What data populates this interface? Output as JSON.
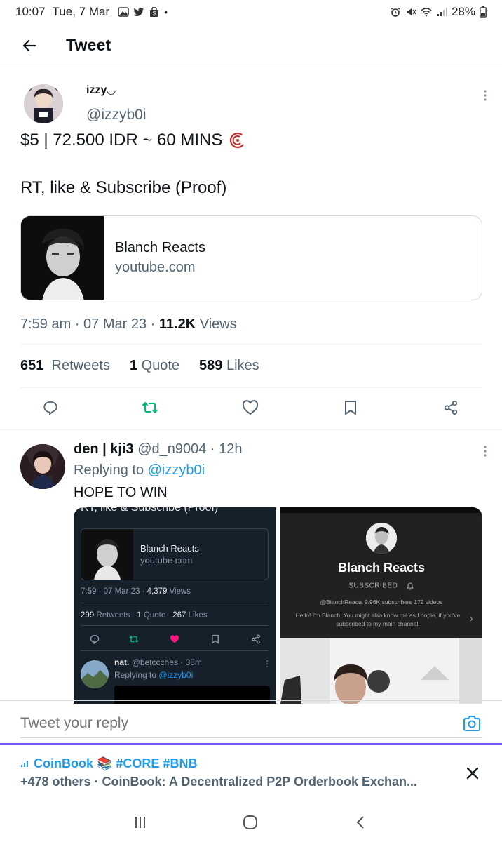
{
  "status_bar": {
    "time": "10:07",
    "date": "Tue, 7 Mar",
    "battery": "28%"
  },
  "header": {
    "title": "Tweet"
  },
  "tweet": {
    "author_name": "izzy◡",
    "author_handle": "@izzyb0i",
    "text_line1": "$5 | 72.500 IDR ~ 60 MINS",
    "text_line2": "RT, like & Subscribe (Proof)",
    "card": {
      "title": "Blanch Reacts",
      "domain": "youtube.com"
    },
    "time": "7:59 am",
    "date": "07 Mar 23",
    "views_count": "11.2K",
    "views_label": "Views",
    "retweets_count": "651",
    "retweets_label": "Retweets",
    "quotes_count": "1",
    "quotes_label": "Quote",
    "likes_count": "589",
    "likes_label": "Likes"
  },
  "reply": {
    "author_name": "den | kji3",
    "author_handle": "@d_n9004",
    "time": "12h",
    "replying_prefix": "Replying to",
    "replying_handle": "@izzyb0i",
    "text": "HOPE TO WIN",
    "media1": {
      "top_text": "RT, like & Subscribe (Proof)",
      "card_title": "Blanch Reacts",
      "card_domain": "youtube.com",
      "meta_time": "7:59 · 07 Mar 23 ·",
      "meta_views_count": "4,379",
      "meta_views_label": "Views",
      "retweets_count": "299",
      "retweets_label": "Retweets",
      "quotes_count": "1",
      "quotes_label": "Quote",
      "likes_count": "267",
      "likes_label": "Likes",
      "reply_name": "nat.",
      "reply_handle_time": "@betccches · 38m",
      "reply_prefix": "Replying to",
      "reply_handle": "@izzyb0i"
    },
    "media2": {
      "channel_name": "Blanch Reacts",
      "subscribed_label": "SUBSCRIBED",
      "stats": "@BlanchReacts  9.96K subscribers  172 videos",
      "description": "Hello! I'm Blanch. You might also know me as Loopie, if you've subscribed to my main channel."
    }
  },
  "composer": {
    "placeholder": "Tweet your reply"
  },
  "trend_banner": {
    "line1": "CoinBook 📚 #CORE #BNB",
    "line2": "+478 others · CoinBook: A Decentralized P2P Orderbook Exchan..."
  },
  "colors": {
    "accent": "#1d9bf0",
    "retweet_green": "#00ba7c",
    "muted": "#536471",
    "purple": "#7856ff"
  }
}
